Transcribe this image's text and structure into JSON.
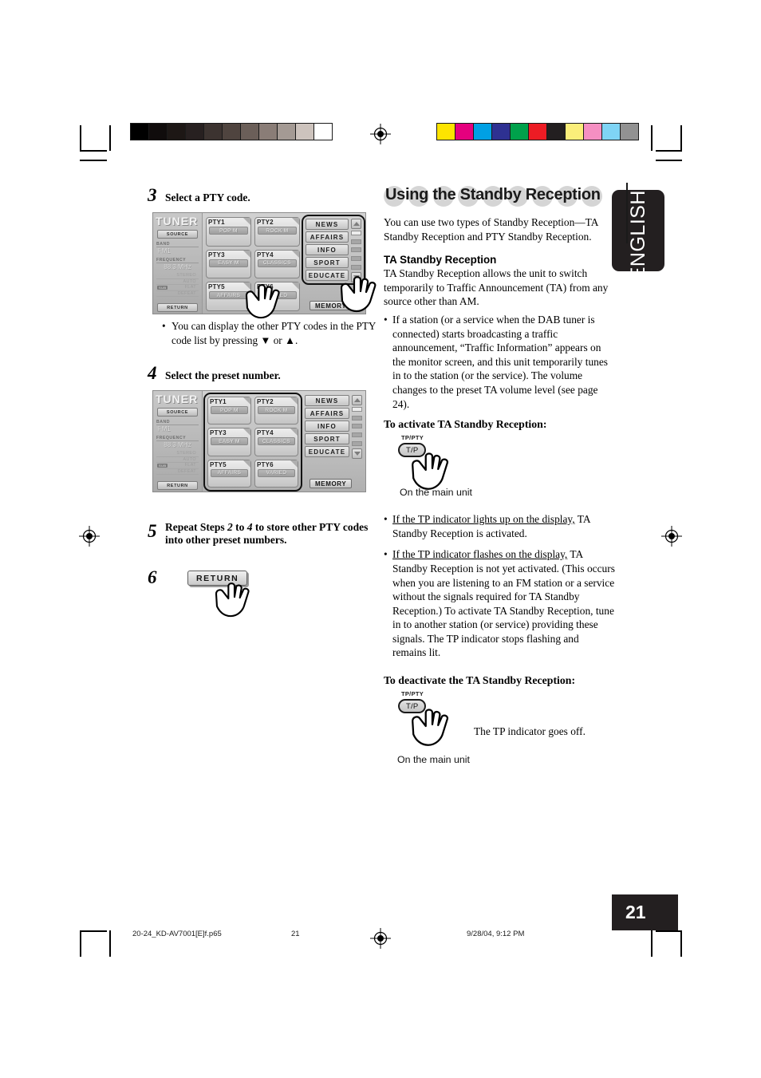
{
  "meta": {
    "language_tab": "ENGLISH",
    "page_number": "21",
    "footer_filename": "20-24_KD-AV7001[E]f.p65",
    "footer_page": "21",
    "footer_timestamp": "9/28/04, 9:12 PM"
  },
  "calibration": {
    "grayscale": [
      "#000000",
      "#100c0c",
      "#1d1715",
      "#272020",
      "#3c3330",
      "#4f443f",
      "#6b5f59",
      "#8a7d77",
      "#a49a94",
      "#cdc3bd",
      "#ffffff"
    ],
    "colors": [
      "#fde400",
      "#e5007e",
      "#00a0e4",
      "#2e3192",
      "#00a14b",
      "#ed1c24",
      "#231f20",
      "#fbee7a",
      "#f58fc2",
      "#7fd4f5",
      "#929292"
    ]
  },
  "left_column": {
    "step3": {
      "number": "3",
      "title": "Select a PTY code.",
      "note": "You can display the other PTY codes in the PTY code list by pressing ▼ or ▲."
    },
    "step4": {
      "number": "4",
      "title": "Select the preset number."
    },
    "step5": {
      "number": "5",
      "title_part1": "Repeat Steps ",
      "title_step_a": "2",
      "title_mid": " to ",
      "title_step_b": "4",
      "title_part2": " to store other PTY codes into other preset numbers."
    },
    "step6": {
      "number": "6",
      "button_label": "RETURN"
    }
  },
  "tuner_panel": {
    "logo": "TUNER",
    "source_button": "SOURCE",
    "band_label": "BAND",
    "band_value": "FM1",
    "frequency_label": "FREQUENCY",
    "frequency_value": "88.3 MHz",
    "eq_rows": [
      {
        "label": "STEREO",
        "chip": ""
      },
      {
        "label": "AUTO",
        "chip": ""
      },
      {
        "label": "FLAT",
        "chip": "SUB"
      },
      {
        "label": "DEFEAT",
        "chip": ""
      }
    ],
    "return_button": "RETURN",
    "memory_button": "MEMORY",
    "pty_buttons": [
      {
        "name": "PTY1",
        "sub": "POP M"
      },
      {
        "name": "PTY2",
        "sub": "ROCK M"
      },
      {
        "name": "PTY3",
        "sub": "EASY M"
      },
      {
        "name": "PTY4",
        "sub": "CLASSICS"
      },
      {
        "name": "PTY5",
        "sub": "AFFAIRS"
      },
      {
        "name": "PTY6",
        "sub": "VARIED"
      }
    ],
    "code_list": [
      "NEWS",
      "AFFAIRS",
      "INFO",
      "SPORT",
      "EDUCATE"
    ],
    "scroll_up_icon": "triangle-up-icon",
    "scroll_down_icon": "triangle-down-icon"
  },
  "right_column": {
    "heading": "Using the Standby Reception",
    "intro": "You can use two types of Standby Reception—TA Standby Reception and PTY Standby Reception.",
    "ta_heading": "TA Standby Reception",
    "ta_intro": "TA Standby Reception allows the unit to switch temporarily to Traffic Announcement (TA) from any source other than AM.",
    "ta_bullet1": "If a station (or a service when the DAB tuner is connected) starts broadcasting a traffic announcement, “Traffic Information” appears on the monitor screen, and this unit temporarily tunes in to the station (or the service). The volume changes to the preset TA volume level (see page 24).",
    "activate_heading": "To activate TA Standby Reception:",
    "tp_button_caption": "TP/PTY",
    "tp_button_label": "T/P",
    "on_main_unit": "On the main unit",
    "bullet_lights_up_underline": "If the TP indicator lights up on the display,",
    "bullet_lights_up_rest": " TA Standby Reception is activated.",
    "bullet_flashes_underline": "If the TP indicator flashes on the display,",
    "bullet_flashes_rest": " TA Standby Reception is not yet activated. (This occurs when you are listening to an FM station or a service without the signals required for TA Standby Reception.) To activate TA Standby Reception, tune in to another station (or service) providing these signals. The TP indicator stops flashing and remains lit.",
    "deactivate_heading": "To deactivate the TA Standby Reception:",
    "deactivate_note": "The TP indicator goes off."
  }
}
